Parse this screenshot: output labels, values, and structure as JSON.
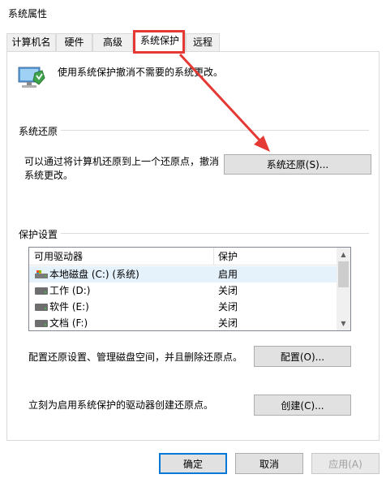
{
  "window": {
    "title": "系统属性"
  },
  "tabs": [
    {
      "label": "计算机名"
    },
    {
      "label": "硬件"
    },
    {
      "label": "高级"
    },
    {
      "label": "系统保护",
      "active": true
    },
    {
      "label": "远程"
    }
  ],
  "intro": {
    "text": "使用系统保护撤消不需要的系统更改。"
  },
  "restore": {
    "group_label": "系统还原",
    "description_line1": "可以通过将计算机还原到上一个还原点，撤消",
    "description_line2": "系统更改。",
    "button_label": "系统还原(S)..."
  },
  "protection": {
    "group_label": "保护设置",
    "columns": {
      "drive": "可用驱动器",
      "protection": "保护"
    },
    "drives": [
      {
        "name": "本地磁盘 (C:) (系统)",
        "protection": "启用",
        "icon": "system-drive-icon"
      },
      {
        "name": "工作 (D:)",
        "protection": "关闭",
        "icon": "drive-icon"
      },
      {
        "name": "软件 (E:)",
        "protection": "关闭",
        "icon": "drive-icon"
      },
      {
        "name": "文档 (F:)",
        "protection": "关闭",
        "icon": "drive-icon"
      }
    ],
    "configure_text": "配置还原设置、管理磁盘空间，并且删除还原点。",
    "configure_button": "配置(O)...",
    "create_text": "立刻为启用系统保护的驱动器创建还原点。",
    "create_button": "创建(C)..."
  },
  "footer": {
    "ok_label": "确定",
    "cancel_label": "取消",
    "apply_label": "应用(A)"
  },
  "colors": {
    "annotation": "#e53935",
    "accent": "#0078d7",
    "selection": "#e5f1fb"
  }
}
